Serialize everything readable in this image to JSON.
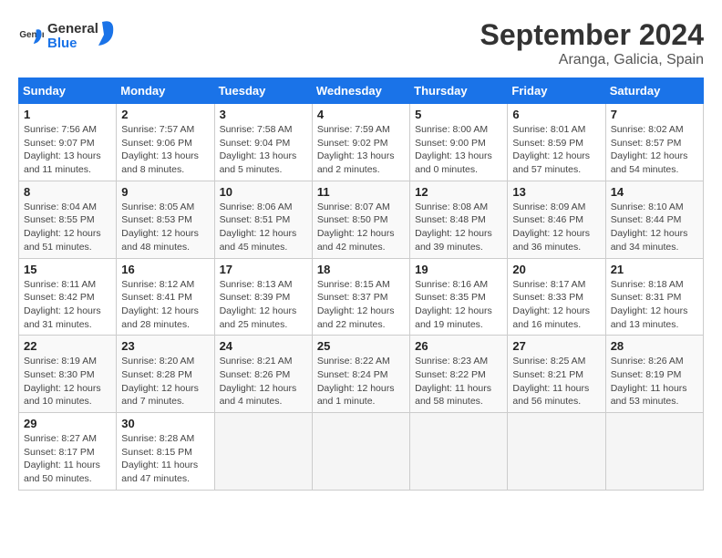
{
  "header": {
    "logo_general": "General",
    "logo_blue": "Blue",
    "title": "September 2024",
    "location": "Aranga, Galicia, Spain"
  },
  "days_of_week": [
    "Sunday",
    "Monday",
    "Tuesday",
    "Wednesday",
    "Thursday",
    "Friday",
    "Saturday"
  ],
  "weeks": [
    [
      {
        "day": "1",
        "detail": "Sunrise: 7:56 AM\nSunset: 9:07 PM\nDaylight: 13 hours and 11 minutes."
      },
      {
        "day": "2",
        "detail": "Sunrise: 7:57 AM\nSunset: 9:06 PM\nDaylight: 13 hours and 8 minutes."
      },
      {
        "day": "3",
        "detail": "Sunrise: 7:58 AM\nSunset: 9:04 PM\nDaylight: 13 hours and 5 minutes."
      },
      {
        "day": "4",
        "detail": "Sunrise: 7:59 AM\nSunset: 9:02 PM\nDaylight: 13 hours and 2 minutes."
      },
      {
        "day": "5",
        "detail": "Sunrise: 8:00 AM\nSunset: 9:00 PM\nDaylight: 13 hours and 0 minutes."
      },
      {
        "day": "6",
        "detail": "Sunrise: 8:01 AM\nSunset: 8:59 PM\nDaylight: 12 hours and 57 minutes."
      },
      {
        "day": "7",
        "detail": "Sunrise: 8:02 AM\nSunset: 8:57 PM\nDaylight: 12 hours and 54 minutes."
      }
    ],
    [
      {
        "day": "8",
        "detail": "Sunrise: 8:04 AM\nSunset: 8:55 PM\nDaylight: 12 hours and 51 minutes."
      },
      {
        "day": "9",
        "detail": "Sunrise: 8:05 AM\nSunset: 8:53 PM\nDaylight: 12 hours and 48 minutes."
      },
      {
        "day": "10",
        "detail": "Sunrise: 8:06 AM\nSunset: 8:51 PM\nDaylight: 12 hours and 45 minutes."
      },
      {
        "day": "11",
        "detail": "Sunrise: 8:07 AM\nSunset: 8:50 PM\nDaylight: 12 hours and 42 minutes."
      },
      {
        "day": "12",
        "detail": "Sunrise: 8:08 AM\nSunset: 8:48 PM\nDaylight: 12 hours and 39 minutes."
      },
      {
        "day": "13",
        "detail": "Sunrise: 8:09 AM\nSunset: 8:46 PM\nDaylight: 12 hours and 36 minutes."
      },
      {
        "day": "14",
        "detail": "Sunrise: 8:10 AM\nSunset: 8:44 PM\nDaylight: 12 hours and 34 minutes."
      }
    ],
    [
      {
        "day": "15",
        "detail": "Sunrise: 8:11 AM\nSunset: 8:42 PM\nDaylight: 12 hours and 31 minutes."
      },
      {
        "day": "16",
        "detail": "Sunrise: 8:12 AM\nSunset: 8:41 PM\nDaylight: 12 hours and 28 minutes."
      },
      {
        "day": "17",
        "detail": "Sunrise: 8:13 AM\nSunset: 8:39 PM\nDaylight: 12 hours and 25 minutes."
      },
      {
        "day": "18",
        "detail": "Sunrise: 8:15 AM\nSunset: 8:37 PM\nDaylight: 12 hours and 22 minutes."
      },
      {
        "day": "19",
        "detail": "Sunrise: 8:16 AM\nSunset: 8:35 PM\nDaylight: 12 hours and 19 minutes."
      },
      {
        "day": "20",
        "detail": "Sunrise: 8:17 AM\nSunset: 8:33 PM\nDaylight: 12 hours and 16 minutes."
      },
      {
        "day": "21",
        "detail": "Sunrise: 8:18 AM\nSunset: 8:31 PM\nDaylight: 12 hours and 13 minutes."
      }
    ],
    [
      {
        "day": "22",
        "detail": "Sunrise: 8:19 AM\nSunset: 8:30 PM\nDaylight: 12 hours and 10 minutes."
      },
      {
        "day": "23",
        "detail": "Sunrise: 8:20 AM\nSunset: 8:28 PM\nDaylight: 12 hours and 7 minutes."
      },
      {
        "day": "24",
        "detail": "Sunrise: 8:21 AM\nSunset: 8:26 PM\nDaylight: 12 hours and 4 minutes."
      },
      {
        "day": "25",
        "detail": "Sunrise: 8:22 AM\nSunset: 8:24 PM\nDaylight: 12 hours and 1 minute."
      },
      {
        "day": "26",
        "detail": "Sunrise: 8:23 AM\nSunset: 8:22 PM\nDaylight: 11 hours and 58 minutes."
      },
      {
        "day": "27",
        "detail": "Sunrise: 8:25 AM\nSunset: 8:21 PM\nDaylight: 11 hours and 56 minutes."
      },
      {
        "day": "28",
        "detail": "Sunrise: 8:26 AM\nSunset: 8:19 PM\nDaylight: 11 hours and 53 minutes."
      }
    ],
    [
      {
        "day": "29",
        "detail": "Sunrise: 8:27 AM\nSunset: 8:17 PM\nDaylight: 11 hours and 50 minutes."
      },
      {
        "day": "30",
        "detail": "Sunrise: 8:28 AM\nSunset: 8:15 PM\nDaylight: 11 hours and 47 minutes."
      },
      {
        "day": "",
        "detail": ""
      },
      {
        "day": "",
        "detail": ""
      },
      {
        "day": "",
        "detail": ""
      },
      {
        "day": "",
        "detail": ""
      },
      {
        "day": "",
        "detail": ""
      }
    ]
  ]
}
